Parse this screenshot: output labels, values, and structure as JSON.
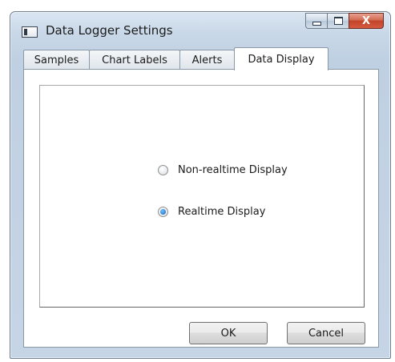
{
  "window": {
    "title": "Data Logger Settings",
    "icon": "app-window-icon",
    "caption": {
      "minimize": "minimize-icon",
      "maximize": "maximize-icon",
      "close": "X"
    }
  },
  "tabs": [
    {
      "label": "Samples"
    },
    {
      "label": "Chart Labels"
    },
    {
      "label": "Alerts"
    },
    {
      "label": "Data Display",
      "active": true
    }
  ],
  "options": [
    {
      "label": "Non-realtime Display",
      "checked": false
    },
    {
      "label": "Realtime Display",
      "checked": true
    }
  ],
  "buttons": {
    "ok": "OK",
    "cancel": "Cancel"
  }
}
